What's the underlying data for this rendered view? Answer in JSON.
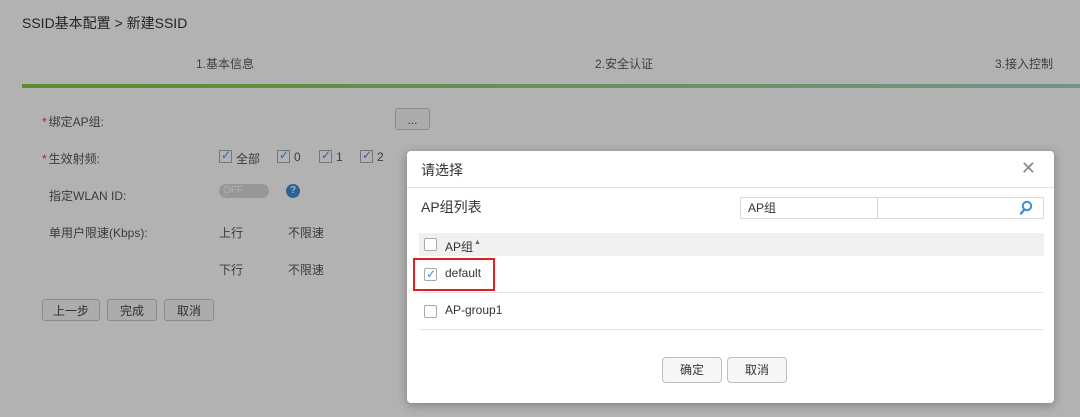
{
  "breadcrumb": "SSID基本配置 > 新建SSID",
  "steps": [
    "1.基本信息",
    "2.安全认证",
    "3.接入控制"
  ],
  "form": {
    "bind_ap_group": {
      "label": "绑定AP组:",
      "button": "..."
    },
    "radio": {
      "label": "生效射频:",
      "options": [
        "全部",
        "0",
        "1",
        "2"
      ]
    },
    "wlan_id": {
      "label": "指定WLAN ID:",
      "toggle": "OFF",
      "help": "?"
    },
    "rate_limit": {
      "label": "单用户限速(Kbps):",
      "up_label": "上行",
      "up_value": "不限速",
      "down_label": "下行",
      "down_value": "不限速"
    }
  },
  "actions": {
    "prev": "上一步",
    "finish": "完成",
    "cancel": "取消"
  },
  "dialog": {
    "title": "请选择",
    "close": "✕",
    "list_title": "AP组列表",
    "search_field": "AP组",
    "search_placeholder": "",
    "column_header": "AP组",
    "sort_indicator": "▲",
    "rows": [
      {
        "name": "default",
        "checked": true
      },
      {
        "name": "AP-group1",
        "checked": false
      }
    ],
    "ok": "确定",
    "cancel": "取消"
  },
  "colors": {
    "accent": "#3b8fd8",
    "highlight": "#e02020",
    "step_bar_start": "#8cc63f",
    "step_bar_end": "#a4d4c5"
  }
}
